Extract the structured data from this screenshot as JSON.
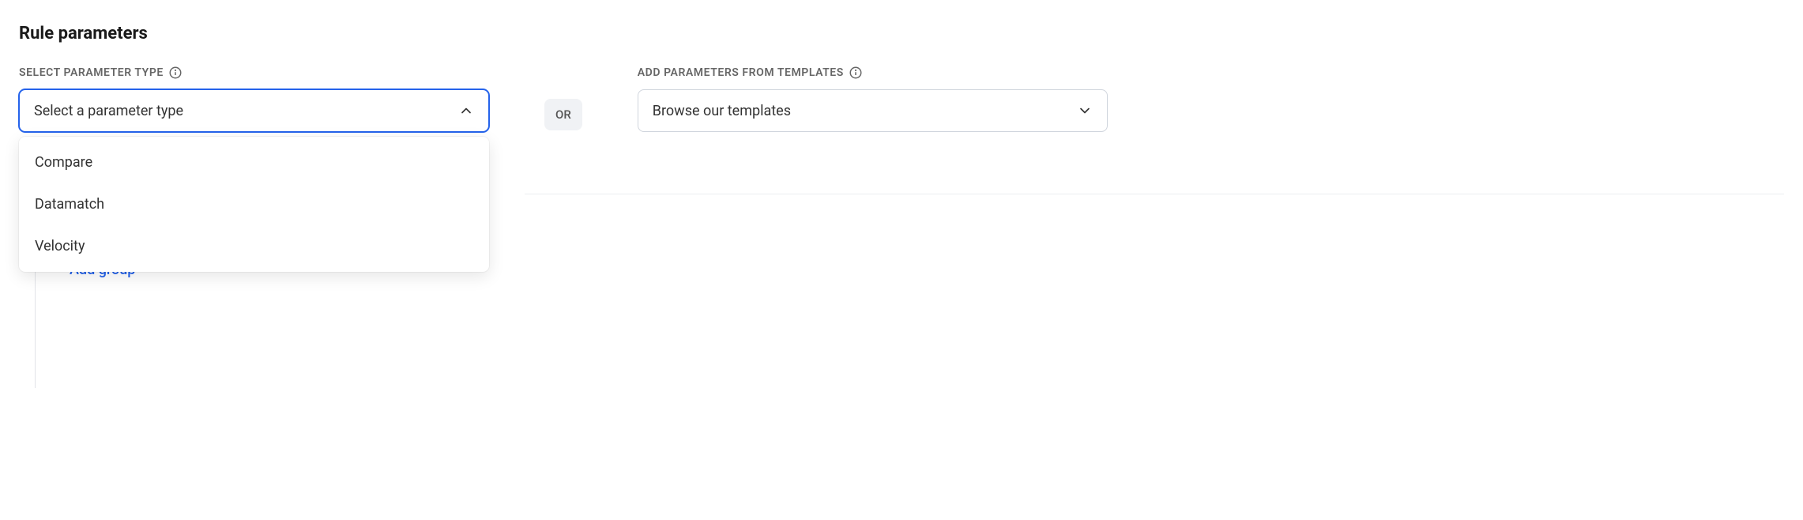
{
  "section": {
    "title": "Rule parameters"
  },
  "left": {
    "label": "SELECT PARAMETER TYPE",
    "placeholder": "Select a parameter type",
    "options": [
      "Compare",
      "Datamatch",
      "Velocity"
    ]
  },
  "separator": {
    "text": "OR"
  },
  "right": {
    "label": "ADD PARAMETERS FROM TEMPLATES",
    "placeholder": "Browse our templates"
  },
  "tree": {
    "add_group": "Add group"
  }
}
